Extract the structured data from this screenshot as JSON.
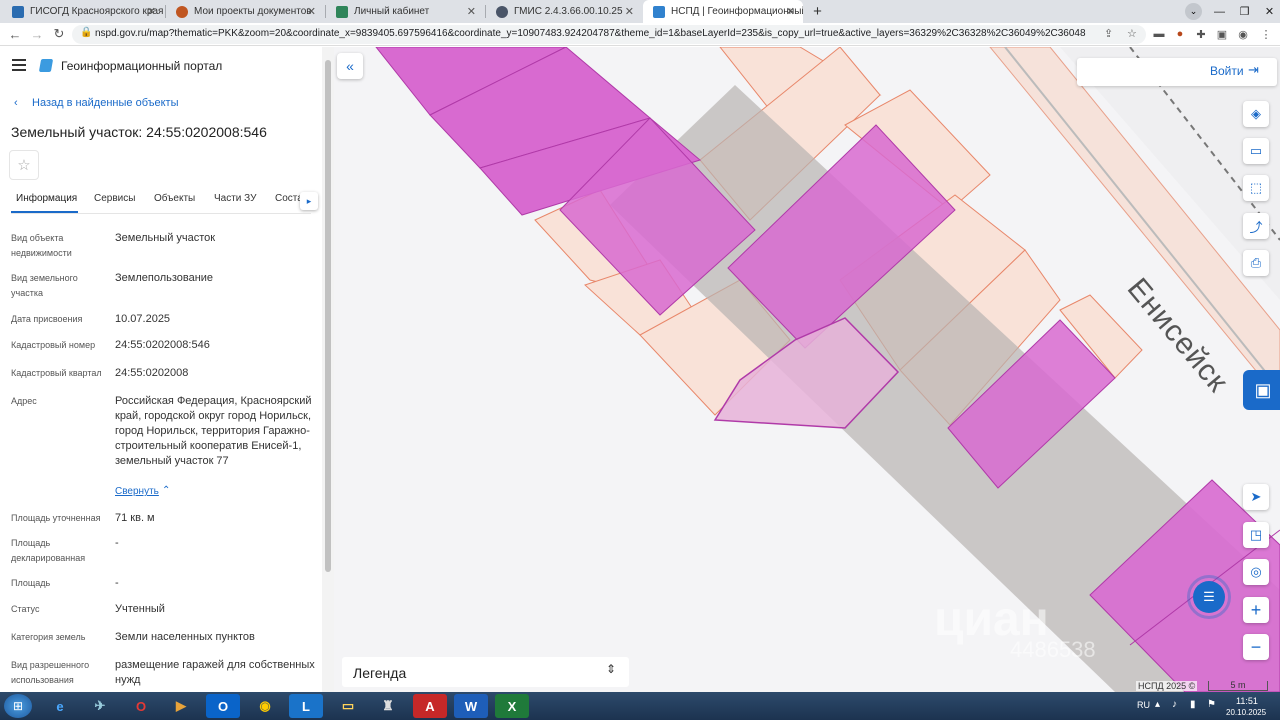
{
  "browser": {
    "tabs": [
      {
        "label": "ГИСОГД Красноярского края",
        "color": "#2b6cb0"
      },
      {
        "label": "Мои проекты документов",
        "color": "#c05621"
      },
      {
        "label": "Личный кабинет",
        "color": "#2f855a"
      },
      {
        "label": "ГМИС 2.4.3.66.00.10.25",
        "color": "#4a5568"
      },
      {
        "label": "НСПД | Геоинформационный п",
        "color": "#3182ce"
      }
    ],
    "url": "nspd.gov.ru/map?thematic=PKK&zoom=20&coordinate_x=9839405.697596416&coordinate_y=10907483.924204787&theme_id=1&baseLayerId=235&is_copy_url=true&active_layers=36329%2C36328%2C36049%2C36048"
  },
  "panel": {
    "portal_title": "Геоинформационный портал",
    "back_link": "Назад в найденные объекты",
    "object_title": "Земельный участок: 24:55:0202008:546",
    "tabs": [
      "Информация",
      "Сервисы",
      "Объекты",
      "Части ЗУ",
      "Соста"
    ],
    "fields": [
      {
        "label": "Вид объекта недвижимости",
        "value": "Земельный участок"
      },
      {
        "label": "Вид земельного участка",
        "value": "Землепользование"
      },
      {
        "label": "Дата присвоения",
        "value": "10.07.2025"
      },
      {
        "label": "Кадастровый номер",
        "value": "24:55:0202008:546"
      },
      {
        "label": "Кадастровый квартал",
        "value": "24:55:0202008"
      },
      {
        "label": "Адрес",
        "value": "Российская Федерация, Красноярский край, городской округ город Норильск, город Норильск, территория Гаражно-строительный кооператив Енисей-1, земельный участок 77"
      },
      {
        "label": "Площадь уточненная",
        "value": "71 кв. м"
      },
      {
        "label": "Площадь декларированная",
        "value": "-"
      },
      {
        "label": "Площадь",
        "value": "-"
      },
      {
        "label": "Статус",
        "value": "Учтенный"
      },
      {
        "label": "Категория земель",
        "value": "Земли населенных пунктов"
      },
      {
        "label": "Вид разрешенного использования",
        "value": "размещение гаражей для собственных нужд"
      }
    ],
    "collapse_link": "Свернуть"
  },
  "map": {
    "login": "Войти",
    "street_label": "Енисейск",
    "legend": "Легенда",
    "copyright": "НСПД 2025 ©",
    "scale": "5 m",
    "watermark": "циан",
    "watermark_phone": "4486538"
  },
  "taskbar": {
    "lang": "RU",
    "time": "11:51",
    "date": "20.10.2025"
  }
}
